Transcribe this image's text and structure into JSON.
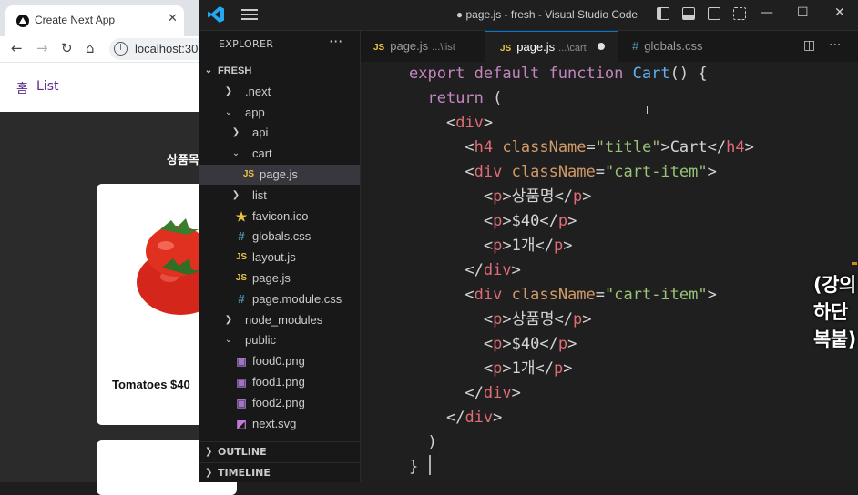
{
  "browser": {
    "tab_title": "Create Next App",
    "tab_close": "✕",
    "address": "localhost:300",
    "nav_home": "홈",
    "nav_list": "List",
    "page_heading": "상품목",
    "product_caption": "Tomatoes $40"
  },
  "vscode": {
    "window_title": "● page.js - fresh - Visual Studio Code",
    "explorer_title": "EXPLORER",
    "tabs": [
      {
        "icon": "JS",
        "name": "page.js",
        "path": "...\\list",
        "active": false
      },
      {
        "icon": "JS",
        "name": "page.js",
        "path": "...\\cart",
        "active": true,
        "modified": true
      },
      {
        "icon": "#",
        "name": "globals.css",
        "path": "",
        "active": false
      }
    ],
    "tree": [
      {
        "label": "FRESH",
        "type": "root"
      },
      {
        "label": ".next",
        "type": "folder"
      },
      {
        "label": "app",
        "type": "folder-open"
      },
      {
        "label": "api",
        "type": "folder"
      },
      {
        "label": "cart",
        "type": "folder-open"
      },
      {
        "label": "page.js",
        "type": "js",
        "selected": true
      },
      {
        "label": "list",
        "type": "folder"
      },
      {
        "label": "favicon.ico",
        "type": "ico"
      },
      {
        "label": "globals.css",
        "type": "css"
      },
      {
        "label": "layout.js",
        "type": "js"
      },
      {
        "label": "page.js",
        "type": "js"
      },
      {
        "label": "page.module.css",
        "type": "css"
      },
      {
        "label": "node_modules",
        "type": "folder"
      },
      {
        "label": "public",
        "type": "folder-open"
      },
      {
        "label": "food0.png",
        "type": "img"
      },
      {
        "label": "food1.png",
        "type": "img"
      },
      {
        "label": "food2.png",
        "type": "img"
      },
      {
        "label": "next.svg",
        "type": "svg"
      }
    ],
    "sections": [
      "OUTLINE",
      "TIMELINE"
    ],
    "code": [
      "export default function Cart() {",
      "  return (",
      "    <div>",
      "      <h4 className=\"title\">Cart</h4>",
      "      <div className=\"cart-item\">",
      "        <p>상품명</p>",
      "        <p>$40</p>",
      "        <p>1개</p>",
      "      </div>",
      "      <div className=\"cart-item\">",
      "        <p>상품명</p>",
      "        <p>$40</p>",
      "        <p>1개</p>",
      "      </div>",
      "    </div>",
      "  )",
      "}"
    ],
    "overlay_caption": "(강의하단 복붙)"
  },
  "colors": {
    "keyword": "#c586c0",
    "function": "#61afef",
    "tag": "#e06c75",
    "attribute": "#d19a66",
    "string": "#98c379",
    "accent": "#0078d4"
  }
}
